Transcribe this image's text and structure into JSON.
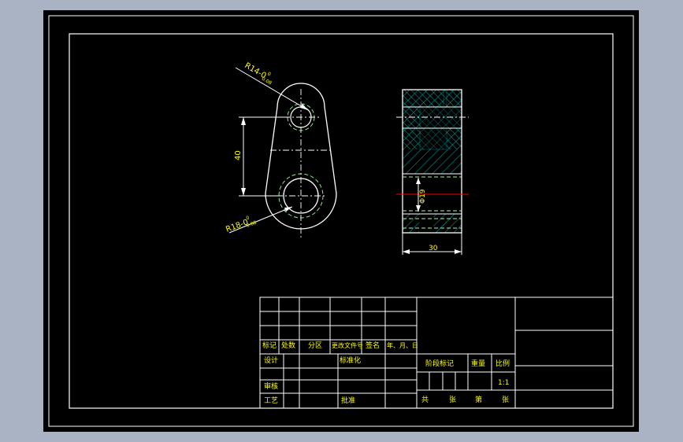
{
  "colors": {
    "background": "#000000",
    "frame": "#ffffff",
    "outline": "#ffffff",
    "dimension": "#ffffff",
    "text": "#ffff00",
    "hatch": "#00a0a0",
    "hidden_line": "#9aff9a",
    "center_line": "#ff0000"
  },
  "drawing": {
    "front_view": {
      "dim_upper_radius": "R14-0",
      "dim_upper_tol_top": "0",
      "dim_upper_tol_bottom": "0.08",
      "dim_lower_radius": "R18-0",
      "dim_lower_tol_top": "0",
      "dim_lower_tol_bottom": "0.08",
      "dim_center_distance": "40"
    },
    "side_view": {
      "dim_bore_diameter": "Φ19",
      "dim_width": "30"
    }
  },
  "title_block": {
    "rev_headers": [
      "标记",
      "处数",
      "分区",
      "更改文件号",
      "签名",
      "年、月、日"
    ],
    "design_label": "设计",
    "standardize_label": "标准化",
    "review_label": "审核",
    "process_label": "工艺",
    "approve_label": "批准",
    "stage_label": "阶段标记",
    "weight_label": "重量",
    "scale_label": "比例",
    "scale_value": "1:1",
    "sheet_total_label": "共",
    "sheet_unit_label": "张",
    "sheet_no_label": "第",
    "sheet_unit2_label": "张"
  }
}
